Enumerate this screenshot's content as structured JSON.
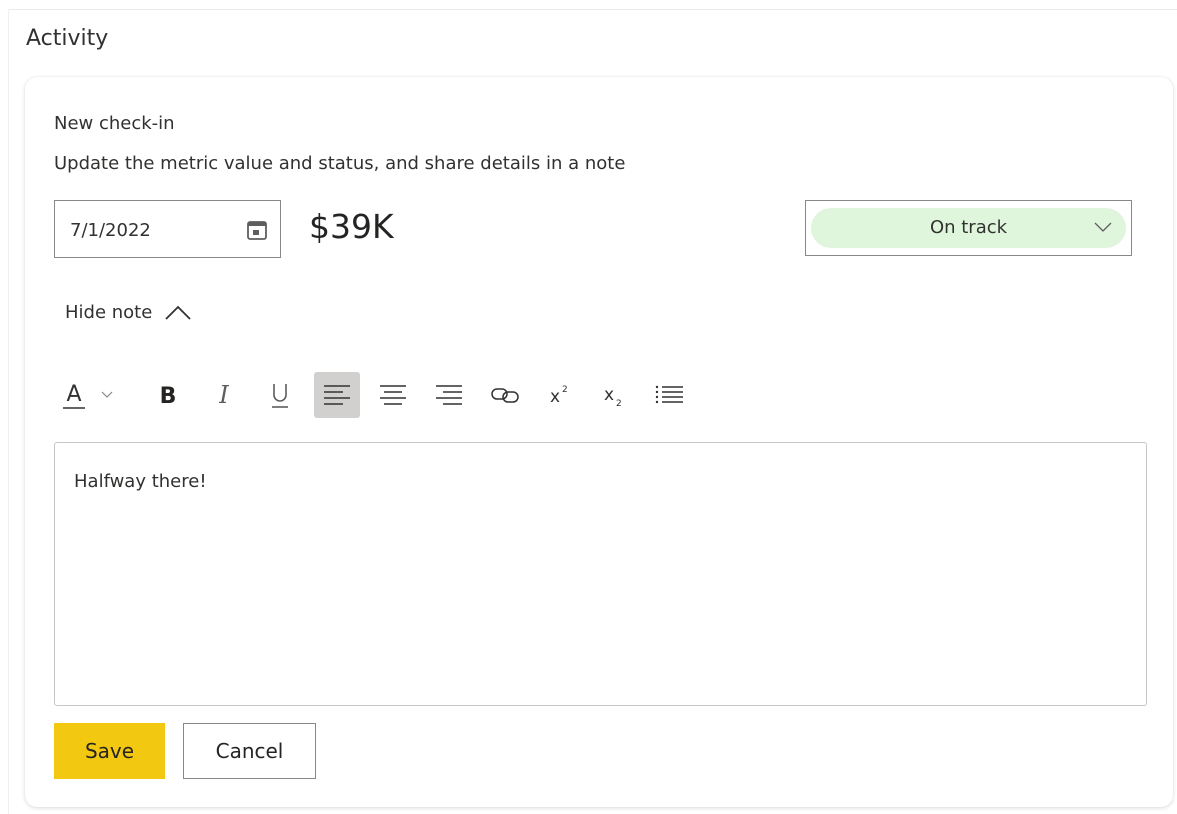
{
  "section": {
    "title": "Activity"
  },
  "checkin": {
    "title": "New check-in",
    "subtitle": "Update the metric value and status, and share details in a note",
    "date": "7/1/2022",
    "date_icon": "calendar-icon",
    "metric_value": "$39K",
    "status": {
      "selected": "On track",
      "color": "#dff6dd"
    },
    "toggle_note_label": "Hide note"
  },
  "toolbar": {
    "tools": [
      {
        "name": "font-color",
        "icon": "font-color-icon",
        "active": false
      },
      {
        "name": "font-color-dropdown",
        "icon": "chevron-down-icon",
        "active": false
      },
      {
        "name": "bold",
        "icon": "bold-icon",
        "active": false
      },
      {
        "name": "italic",
        "icon": "italic-icon",
        "active": false
      },
      {
        "name": "underline",
        "icon": "underline-icon",
        "active": false
      },
      {
        "name": "align-left",
        "icon": "align-left-icon",
        "active": true
      },
      {
        "name": "align-center",
        "icon": "align-center-icon",
        "active": false
      },
      {
        "name": "align-right",
        "icon": "align-right-icon",
        "active": false
      },
      {
        "name": "link",
        "icon": "link-icon",
        "active": false
      },
      {
        "name": "superscript",
        "icon": "superscript-icon",
        "active": false
      },
      {
        "name": "subscript",
        "icon": "subscript-icon",
        "active": false
      },
      {
        "name": "bulleted-list",
        "icon": "bullet-list-icon",
        "active": false
      }
    ]
  },
  "note": {
    "text": "Halfway there!"
  },
  "buttons": {
    "save": "Save",
    "cancel": "Cancel"
  },
  "colors": {
    "accent": "#f2c811",
    "status_bg": "#dff6dd",
    "active_tool": "#d2d0ce"
  }
}
